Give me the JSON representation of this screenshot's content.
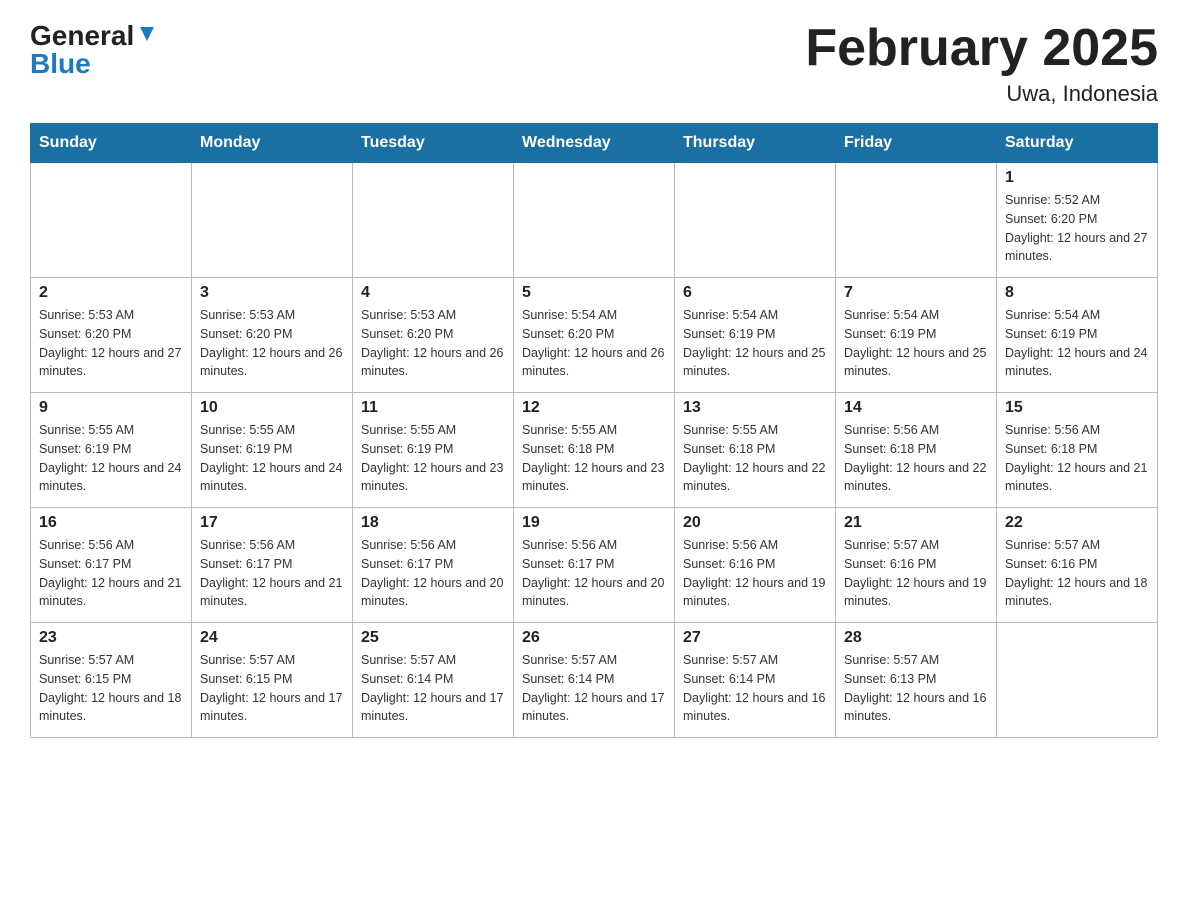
{
  "header": {
    "logo_general": "General",
    "logo_blue": "Blue",
    "title": "February 2025",
    "subtitle": "Uwa, Indonesia"
  },
  "days_of_week": [
    "Sunday",
    "Monday",
    "Tuesday",
    "Wednesday",
    "Thursday",
    "Friday",
    "Saturday"
  ],
  "weeks": [
    [
      {
        "day": "",
        "info": ""
      },
      {
        "day": "",
        "info": ""
      },
      {
        "day": "",
        "info": ""
      },
      {
        "day": "",
        "info": ""
      },
      {
        "day": "",
        "info": ""
      },
      {
        "day": "",
        "info": ""
      },
      {
        "day": "1",
        "info": "Sunrise: 5:52 AM\nSunset: 6:20 PM\nDaylight: 12 hours and 27 minutes."
      }
    ],
    [
      {
        "day": "2",
        "info": "Sunrise: 5:53 AM\nSunset: 6:20 PM\nDaylight: 12 hours and 27 minutes."
      },
      {
        "day": "3",
        "info": "Sunrise: 5:53 AM\nSunset: 6:20 PM\nDaylight: 12 hours and 26 minutes."
      },
      {
        "day": "4",
        "info": "Sunrise: 5:53 AM\nSunset: 6:20 PM\nDaylight: 12 hours and 26 minutes."
      },
      {
        "day": "5",
        "info": "Sunrise: 5:54 AM\nSunset: 6:20 PM\nDaylight: 12 hours and 26 minutes."
      },
      {
        "day": "6",
        "info": "Sunrise: 5:54 AM\nSunset: 6:19 PM\nDaylight: 12 hours and 25 minutes."
      },
      {
        "day": "7",
        "info": "Sunrise: 5:54 AM\nSunset: 6:19 PM\nDaylight: 12 hours and 25 minutes."
      },
      {
        "day": "8",
        "info": "Sunrise: 5:54 AM\nSunset: 6:19 PM\nDaylight: 12 hours and 24 minutes."
      }
    ],
    [
      {
        "day": "9",
        "info": "Sunrise: 5:55 AM\nSunset: 6:19 PM\nDaylight: 12 hours and 24 minutes."
      },
      {
        "day": "10",
        "info": "Sunrise: 5:55 AM\nSunset: 6:19 PM\nDaylight: 12 hours and 24 minutes."
      },
      {
        "day": "11",
        "info": "Sunrise: 5:55 AM\nSunset: 6:19 PM\nDaylight: 12 hours and 23 minutes."
      },
      {
        "day": "12",
        "info": "Sunrise: 5:55 AM\nSunset: 6:18 PM\nDaylight: 12 hours and 23 minutes."
      },
      {
        "day": "13",
        "info": "Sunrise: 5:55 AM\nSunset: 6:18 PM\nDaylight: 12 hours and 22 minutes."
      },
      {
        "day": "14",
        "info": "Sunrise: 5:56 AM\nSunset: 6:18 PM\nDaylight: 12 hours and 22 minutes."
      },
      {
        "day": "15",
        "info": "Sunrise: 5:56 AM\nSunset: 6:18 PM\nDaylight: 12 hours and 21 minutes."
      }
    ],
    [
      {
        "day": "16",
        "info": "Sunrise: 5:56 AM\nSunset: 6:17 PM\nDaylight: 12 hours and 21 minutes."
      },
      {
        "day": "17",
        "info": "Sunrise: 5:56 AM\nSunset: 6:17 PM\nDaylight: 12 hours and 21 minutes."
      },
      {
        "day": "18",
        "info": "Sunrise: 5:56 AM\nSunset: 6:17 PM\nDaylight: 12 hours and 20 minutes."
      },
      {
        "day": "19",
        "info": "Sunrise: 5:56 AM\nSunset: 6:17 PM\nDaylight: 12 hours and 20 minutes."
      },
      {
        "day": "20",
        "info": "Sunrise: 5:56 AM\nSunset: 6:16 PM\nDaylight: 12 hours and 19 minutes."
      },
      {
        "day": "21",
        "info": "Sunrise: 5:57 AM\nSunset: 6:16 PM\nDaylight: 12 hours and 19 minutes."
      },
      {
        "day": "22",
        "info": "Sunrise: 5:57 AM\nSunset: 6:16 PM\nDaylight: 12 hours and 18 minutes."
      }
    ],
    [
      {
        "day": "23",
        "info": "Sunrise: 5:57 AM\nSunset: 6:15 PM\nDaylight: 12 hours and 18 minutes."
      },
      {
        "day": "24",
        "info": "Sunrise: 5:57 AM\nSunset: 6:15 PM\nDaylight: 12 hours and 17 minutes."
      },
      {
        "day": "25",
        "info": "Sunrise: 5:57 AM\nSunset: 6:14 PM\nDaylight: 12 hours and 17 minutes."
      },
      {
        "day": "26",
        "info": "Sunrise: 5:57 AM\nSunset: 6:14 PM\nDaylight: 12 hours and 17 minutes."
      },
      {
        "day": "27",
        "info": "Sunrise: 5:57 AM\nSunset: 6:14 PM\nDaylight: 12 hours and 16 minutes."
      },
      {
        "day": "28",
        "info": "Sunrise: 5:57 AM\nSunset: 6:13 PM\nDaylight: 12 hours and 16 minutes."
      },
      {
        "day": "",
        "info": ""
      }
    ]
  ]
}
